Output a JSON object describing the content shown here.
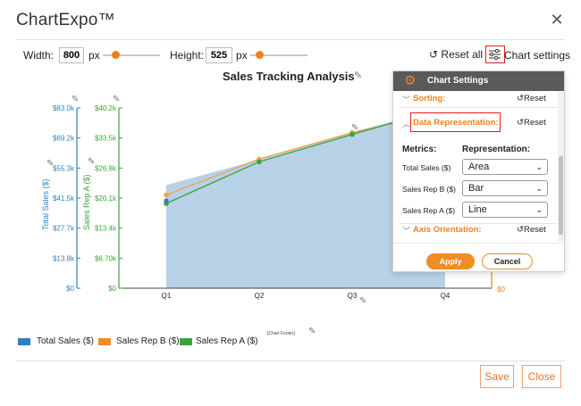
{
  "app": {
    "title": "ChartExpo™"
  },
  "toolbar": {
    "width_label": "Width:",
    "width_value": "800",
    "width_unit": "px",
    "height_label": "Height:",
    "height_value": "525",
    "height_unit": "px",
    "reset_all_label": "Reset all",
    "chart_settings_label": "Chart settings"
  },
  "chart": {
    "title": "Sales Tracking Analysis",
    "left_axis_title": "Total Sales ($)",
    "mid_axis_title": "Sales Rep A ($)",
    "right_axis_zero": "$0",
    "footer": "[Chart Footer]"
  },
  "chart_data": {
    "type": "area",
    "title": "Sales Tracking Analysis",
    "categories": [
      "Q1",
      "Q2",
      "Q3",
      "Q4"
    ],
    "axes": {
      "total_sales": {
        "label": "Total Sales ($)",
        "ticks": [
          "$83.0k",
          "$69.2k",
          "$55.3k",
          "$41.5k",
          "$27.7k",
          "$13.8k",
          "$0"
        ],
        "ylim": [
          0,
          83000
        ]
      },
      "sales_rep_a": {
        "label": "Sales Rep A ($)",
        "ticks": [
          "$40.2k",
          "$33.5k",
          "$26.8k",
          "$20.1k",
          "$13.4k",
          "$6.70k",
          "$0"
        ],
        "ylim": [
          0,
          40200
        ]
      }
    },
    "series": [
      {
        "name": "Total Sales ($)",
        "representation": "Area",
        "axis": "total_sales",
        "color": "#b7d1e7",
        "values": [
          47500,
          59200,
          72000,
          83000
        ]
      },
      {
        "name": "Sales Rep B ($)",
        "representation": "Bar",
        "color": "#f5a04f",
        "values": [
          20800,
          28800,
          34700,
          null
        ]
      },
      {
        "name": "Sales Rep A ($)",
        "representation": "Line",
        "axis": "sales_rep_a",
        "color": "#3aa43a",
        "values": [
          18900,
          28200,
          34300,
          40200
        ]
      }
    ],
    "legend_position": "bottom-left"
  },
  "legend": [
    {
      "label": "Total Sales ($)",
      "color": "#2e7fc2"
    },
    {
      "label": "Sales Rep B ($)",
      "color": "#f28c24"
    },
    {
      "label": "Sales Rep A ($)",
      "color": "#3aa43a"
    }
  ],
  "settings_panel": {
    "header": "Chart Settings",
    "sorting_label": "Sorting:",
    "data_rep_label": "Data Representation:",
    "reset_label": "Reset",
    "metrics_label": "Metrics:",
    "representation_label": "Representation:",
    "rows": [
      {
        "metric": "Total Sales ($)",
        "representation": "Area"
      },
      {
        "metric": "Sales Rep B ($)",
        "representation": "Bar"
      },
      {
        "metric": "Sales Rep A ($)",
        "representation": "Line"
      }
    ],
    "axis_orientation_label": "Axis Orientation:",
    "apply_label": "Apply",
    "cancel_label": "Cancel"
  },
  "footer_buttons": {
    "save_label": "Save",
    "close_label": "Close"
  },
  "colors": {
    "accent": "#f0801d",
    "highlight": "#e21d1d",
    "area": "#b7d1e7",
    "blue_axis": "#2e7fc2",
    "green_axis": "#3aa43a"
  }
}
